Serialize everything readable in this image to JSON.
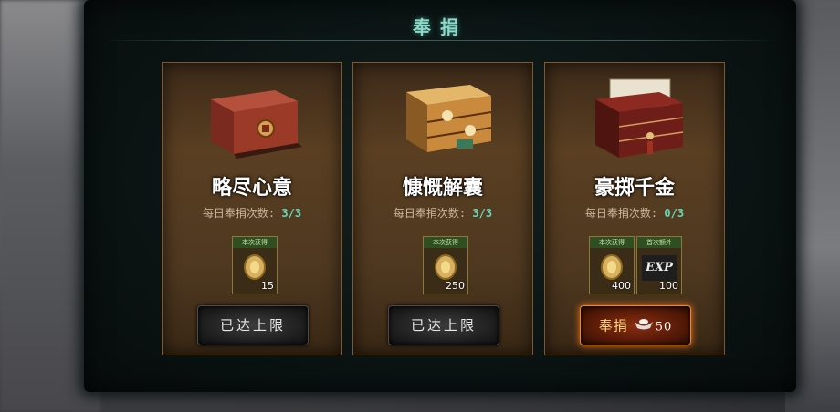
{
  "header": {
    "title": "奉捐"
  },
  "cards": [
    {
      "name": "略尽心意",
      "count_label": "每日奉捐次数:",
      "count_value": "3/3",
      "rewards": [
        {
          "tag": "本次获得",
          "icon": "gold-coin-icon",
          "qty": "15"
        }
      ],
      "button": {
        "label": "已达上限",
        "state": "disabled"
      },
      "chest_color": "#8a2e22"
    },
    {
      "name": "慷慨解囊",
      "count_label": "每日奉捐次数:",
      "count_value": "3/3",
      "rewards": [
        {
          "tag": "本次获得",
          "icon": "gold-coin-icon",
          "qty": "250"
        }
      ],
      "button": {
        "label": "已达上限",
        "state": "disabled"
      },
      "chest_color": "#c98a3e"
    },
    {
      "name": "豪掷千金",
      "count_label": "每日奉捐次数:",
      "count_value": "0/3",
      "rewards": [
        {
          "tag": "本次获得",
          "icon": "gold-coin-icon",
          "qty": "400"
        },
        {
          "tag": "首次额外",
          "icon": "exp-icon",
          "icon_text": "EXP",
          "qty": "100"
        }
      ],
      "button": {
        "label": "奉捐",
        "cost": "50",
        "cost_icon": "silver-ingot-icon",
        "state": "active"
      },
      "chest_color": "#6e1d18"
    }
  ],
  "colors": {
    "accent_teal": "#63d8b8",
    "title": "#8fd7c8",
    "active_button": "#8a2d10"
  }
}
